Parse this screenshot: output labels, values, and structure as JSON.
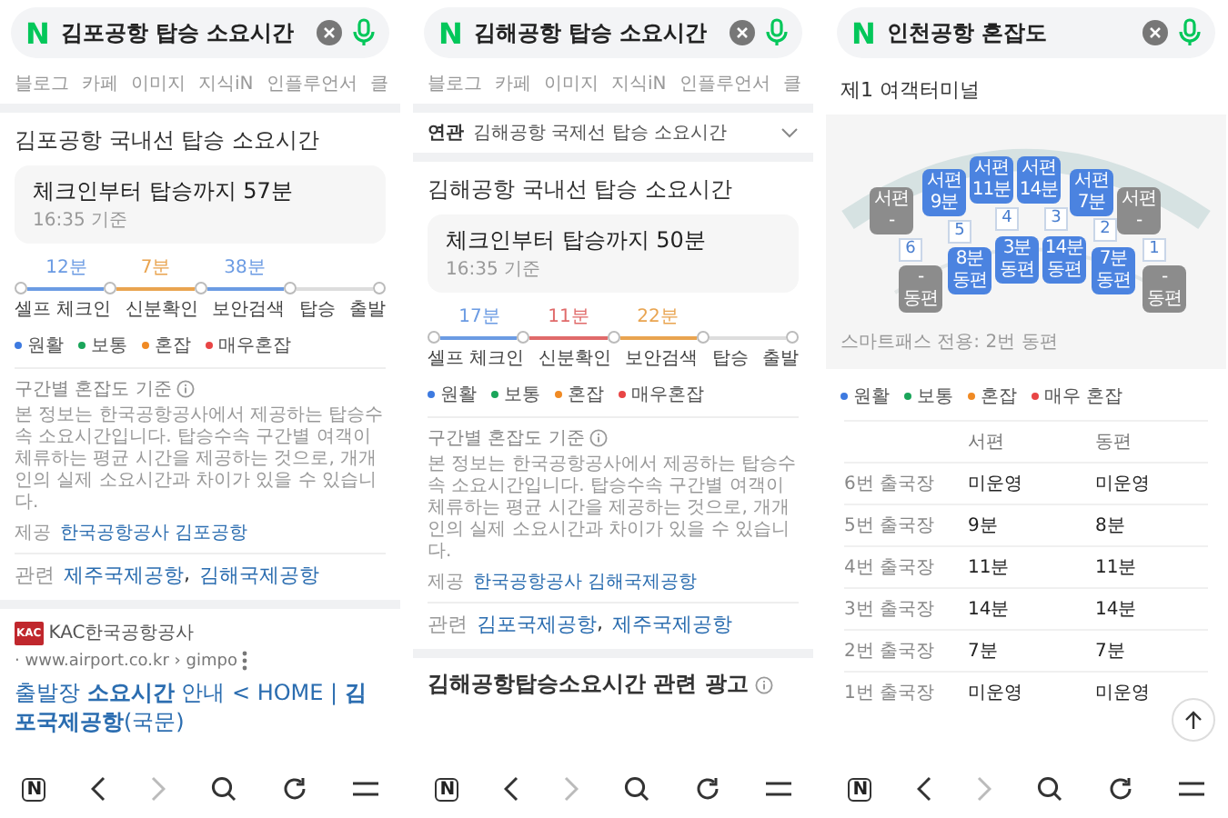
{
  "panels": [
    {
      "kind": "boarding",
      "search": {
        "logo": "N",
        "query": "김포공항 탑승 소요시간"
      },
      "tabs": [
        "블로그",
        "카페",
        "이미지",
        "지식iN",
        "인플루언서",
        "클"
      ],
      "card": {
        "title": "김포공항 국내선 탑승 소요시간",
        "summary": "체크인부터 탑승까지 57분",
        "as_of": "16:35 기준",
        "segments": [
          {
            "duration": "12분",
            "color": "#6b9be3"
          },
          {
            "duration": "7분",
            "color": "#e9a450"
          },
          {
            "duration": "38분",
            "color": "#6b9be3"
          },
          {
            "color": "#dddddd"
          }
        ],
        "stations": [
          "셀프 체크인",
          "신분확인",
          "보안검색",
          "탑승",
          "출발"
        ],
        "legend": [
          {
            "label": "원활",
            "color": "#3d7ae0"
          },
          {
            "label": "보통",
            "color": "#1aa55a"
          },
          {
            "label": "혼잡",
            "color": "#f08a24"
          },
          {
            "label": "매우혼잡",
            "color": "#e84545"
          }
        ],
        "criteria": {
          "title": "구간별 혼잡도 기준",
          "text": "본 정보는 한국공항공사에서 제공하는 탑승수속 소요시간입니다. 탑승수속 구간별 여객이 체류하는 평균 시간을 제공하는 것으로, 개개인의 실제 소요시간과 차이가 있을 수 있습니다."
        },
        "provider": {
          "label": "제공",
          "link": "한국공항공사 김포공항"
        },
        "related": {
          "label": "관련",
          "links": [
            "제주국제공항",
            "김해국제공항"
          ],
          "separator": ","
        }
      },
      "result": {
        "kind": "web",
        "favicon": "KAC",
        "site": "KAC한국공항공사",
        "url": "· www.airport.co.kr › gimpo",
        "title": "출발장 **소요시간** 안내 < HOME | **김포국제공항**(국문)"
      },
      "nav": {
        "home": "N",
        "forward_disabled": true
      }
    },
    {
      "kind": "boarding",
      "search": {
        "logo": "N",
        "query": "김해공항 탑승 소요시간"
      },
      "tabs": [
        "블로그",
        "카페",
        "이미지",
        "지식iN",
        "인플루언서",
        "클"
      ],
      "related_search": {
        "label": "연관",
        "query": "김해공항 국제선 탑승 소요시간"
      },
      "card": {
        "title": "김해공항 국내선 탑승 소요시간",
        "summary": "체크인부터 탑승까지 50분",
        "as_of": "16:35 기준",
        "segments": [
          {
            "duration": "17분",
            "color": "#6b9be3"
          },
          {
            "duration": "11분",
            "color": "#e06a6a"
          },
          {
            "duration": "22분",
            "color": "#e9a450"
          },
          {
            "color": "#dddddd"
          }
        ],
        "stations": [
          "셀프 체크인",
          "신분확인",
          "보안검색",
          "탑승",
          "출발"
        ],
        "legend": [
          {
            "label": "원활",
            "color": "#3d7ae0"
          },
          {
            "label": "보통",
            "color": "#1aa55a"
          },
          {
            "label": "혼잡",
            "color": "#f08a24"
          },
          {
            "label": "매우혼잡",
            "color": "#e84545"
          }
        ],
        "criteria": {
          "title": "구간별 혼잡도 기준",
          "text": "본 정보는 한국공항공사에서 제공하는 탑승수속 소요시간입니다. 탑승수속 구간별 여객이 체류하는 평균 시간을 제공하는 것으로, 개개인의 실제 소요시간과 차이가 있을 수 있습니다."
        },
        "provider": {
          "label": "제공",
          "link": "한국공항공사 김해국제공항"
        },
        "related": {
          "label": "관련",
          "links": [
            "김포국제공항",
            "제주국제공항"
          ],
          "separator": ","
        }
      },
      "result": {
        "kind": "ad_heading",
        "title": "김해공항탑승소요시간 관련 광고"
      },
      "nav": {
        "home": "N",
        "forward_disabled": true
      }
    },
    {
      "kind": "terminal",
      "search": {
        "logo": "N",
        "query": "인천공항 혼잡도"
      },
      "terminal": "제1 여객터미널",
      "gates": [
        {
          "number": "6",
          "west": {
            "label": "서편",
            "time": "-",
            "open": false
          },
          "east": {
            "time": "-",
            "label": "동편",
            "open": false
          }
        },
        {
          "number": "5",
          "west": {
            "label": "서편",
            "time": "9분",
            "open": true
          },
          "east": {
            "time": "8분",
            "label": "동편",
            "open": true
          }
        },
        {
          "number": "4",
          "west": {
            "label": "서편",
            "time": "11분",
            "open": true
          },
          "east": {
            "time": "3분",
            "label": "동편",
            "open": true
          }
        },
        {
          "number": "3",
          "west": {
            "label": "서편",
            "time": "14분",
            "open": true
          },
          "east": {
            "time": "14분",
            "label": "동편",
            "open": true
          }
        },
        {
          "number": "2",
          "west": {
            "label": "서편",
            "time": "7분",
            "open": true
          },
          "east": {
            "time": "7분",
            "label": "동편",
            "open": true
          }
        },
        {
          "number": "1",
          "west": {
            "label": "서편",
            "time": "-",
            "open": false
          },
          "east": {
            "time": "-",
            "label": "동편",
            "open": false
          }
        }
      ],
      "note": "스마트패스 전용: 2번 동편",
      "legend": [
        {
          "label": "원활",
          "color": "#3d7ae0"
        },
        {
          "label": "보통",
          "color": "#1aa55a"
        },
        {
          "label": "혼잡",
          "color": "#f08a24"
        },
        {
          "label": "매우 혼잡",
          "color": "#e84545"
        }
      ],
      "table": {
        "columns": [
          "서편",
          "동편"
        ],
        "rows": [
          {
            "name": "6번 출국장",
            "west": "미운영",
            "east": "미운영"
          },
          {
            "name": "5번 출국장",
            "west": "9분",
            "east": "8분"
          },
          {
            "name": "4번 출국장",
            "west": "11분",
            "east": "11분"
          },
          {
            "name": "3번 출국장",
            "west": "14분",
            "east": "14분"
          },
          {
            "name": "2번 출국장",
            "west": "7분",
            "east": "7분"
          },
          {
            "name": "1번 출국장",
            "west": "미운영",
            "east": "미운영"
          }
        ]
      },
      "nav": {
        "home": "N",
        "forward_disabled": true
      }
    }
  ]
}
